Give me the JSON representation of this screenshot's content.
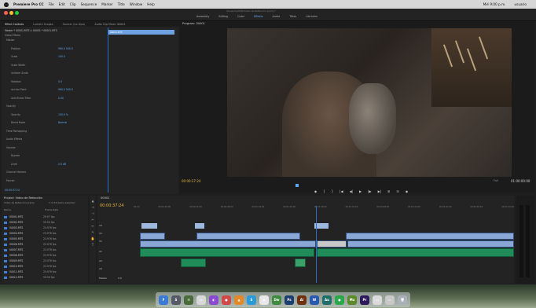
{
  "menubar": {
    "app": "Premiere Pro CC",
    "items": [
      "File",
      "Edit",
      "Clip",
      "Sequence",
      "Marker",
      "Title",
      "Window",
      "Help"
    ],
    "right": [
      "Mié 9:00 p.m.",
      "usuario"
    ]
  },
  "titlebar": {
    "title": "/Usuarios/SSD/Video de Refacción.prproj *"
  },
  "workspaces": [
    "Assembly",
    "Editing",
    "Color",
    "Effects",
    "Audio",
    "Titles",
    "Libraries"
  ],
  "effect_controls": {
    "tabs": [
      "Effect Controls",
      "Lumetri Scopes",
      "Source: (no clips)",
      "Audio Clip Mixer: 00001"
    ],
    "master": "Master * 00001.MTS  >  00001 * 00001.MTS",
    "section_video": "Video Effects",
    "rows": [
      {
        "label": "Motion",
        "value": ""
      },
      {
        "label": "Position",
        "value": "960.0   540.0"
      },
      {
        "label": "Scale",
        "value": "100.0"
      },
      {
        "label": "Scale Width",
        "value": ""
      },
      {
        "label": "Uniform Scale",
        "value": ""
      },
      {
        "label": "Rotation",
        "value": "0.0"
      },
      {
        "label": "Anchor Point",
        "value": "960.0   540.0"
      },
      {
        "label": "Anti-flicker Filter",
        "value": "0.00"
      },
      {
        "label": "Opacity",
        "value": ""
      },
      {
        "label": "Opacity",
        "value": "100.0 %"
      },
      {
        "label": "Blend Mode",
        "value": "Normal"
      },
      {
        "label": "Time Remapping",
        "value": ""
      },
      {
        "label": "Audio Effects",
        "value": ""
      },
      {
        "label": "Volume",
        "value": ""
      },
      {
        "label": "Bypass",
        "value": ""
      },
      {
        "label": "Level",
        "value": "0.0 dB"
      },
      {
        "label": "Channel Volume",
        "value": ""
      },
      {
        "label": "Panner",
        "value": ""
      }
    ],
    "clip_label": "00001.MTS",
    "timecode": "00:00:37:24"
  },
  "program": {
    "title": "Program: 00001",
    "timecode": "00:00:37:24",
    "fit": "Full",
    "duration": "01:00:00:00",
    "transport": [
      "◆",
      "{",
      "}",
      "|◀",
      "◀|",
      "▶",
      "|▶",
      "▶|",
      "⊞",
      "⊟",
      "◉"
    ]
  },
  "project": {
    "title": "Project: Video de Refacción",
    "path": "Video de Refacción.prproj",
    "count": "1 of 14 items selected",
    "columns": [
      "Name",
      "Frame Rate"
    ],
    "items": [
      {
        "name": "00001.MTS",
        "fps": "29.97 fps"
      },
      {
        "name": "00002.MTS",
        "fps": "59.94 fps"
      },
      {
        "name": "00003.MTS",
        "fps": "23.976 fps"
      },
      {
        "name": "00004.MTS",
        "fps": "23.976 fps"
      },
      {
        "name": "00005.MTS",
        "fps": "23.976 fps"
      },
      {
        "name": "00006.MTS",
        "fps": "23.976 fps"
      },
      {
        "name": "00007.MTS",
        "fps": "23.976 fps"
      },
      {
        "name": "00008.MTS",
        "fps": "23.976 fps"
      },
      {
        "name": "00009.MTS",
        "fps": "23.976 fps"
      },
      {
        "name": "00010.MTS",
        "fps": "23.976 fps"
      },
      {
        "name": "00011.MTS",
        "fps": "23.976 fps"
      },
      {
        "name": "00012.MTS",
        "fps": "59.94 fps"
      }
    ]
  },
  "timeline": {
    "tab": "00001",
    "timecode": "00:00:37:24",
    "ruler": [
      "00:00",
      "00:00:16:00",
      "00:00:32:00",
      "00:00:48:00",
      "00:01:04:00",
      "00:01:20:00",
      "00:01:36:00",
      "00:01:52:00",
      "00:02:08:00",
      "00:02:24:00",
      "00:02:40:00",
      "00:02:56:00",
      "00:03:12:00"
    ],
    "tracks": [
      "V3",
      "V2",
      "V1",
      "A1",
      "A2",
      "A3",
      "Master"
    ],
    "master_value": "0.0"
  },
  "dock": [
    {
      "label": "F",
      "color": "#3a7bd5"
    },
    {
      "label": "S",
      "color": "#555a66"
    },
    {
      "label": "☰",
      "color": "#4a6a3a"
    },
    {
      "label": "◎",
      "color": "#d8d8d8"
    },
    {
      "label": "◐",
      "color": "#8a4ad0"
    },
    {
      "label": "●",
      "color": "#d04a4a"
    },
    {
      "label": "▲",
      "color": "#e08a2a"
    },
    {
      "label": "S",
      "color": "#2a9ad8"
    },
    {
      "label": "◉",
      "color": "#e8e8e8"
    },
    {
      "label": "Dw",
      "color": "#3e8a3e"
    },
    {
      "label": "Ps",
      "color": "#1c3e6e"
    },
    {
      "label": "Ai",
      "color": "#6e3010"
    },
    {
      "label": "W",
      "color": "#2a5ab0"
    },
    {
      "label": "Au",
      "color": "#1f6e6a"
    },
    {
      "label": "●",
      "color": "#2aa84a"
    },
    {
      "label": "Mu",
      "color": "#5a8a2a"
    },
    {
      "label": "Pr",
      "color": "#2c1a5a"
    },
    {
      "label": "▭",
      "color": "#dadada"
    },
    {
      "label": "▭",
      "color": "#c8c8c8"
    },
    {
      "label": "🗑",
      "color": "#aab0b8"
    }
  ]
}
